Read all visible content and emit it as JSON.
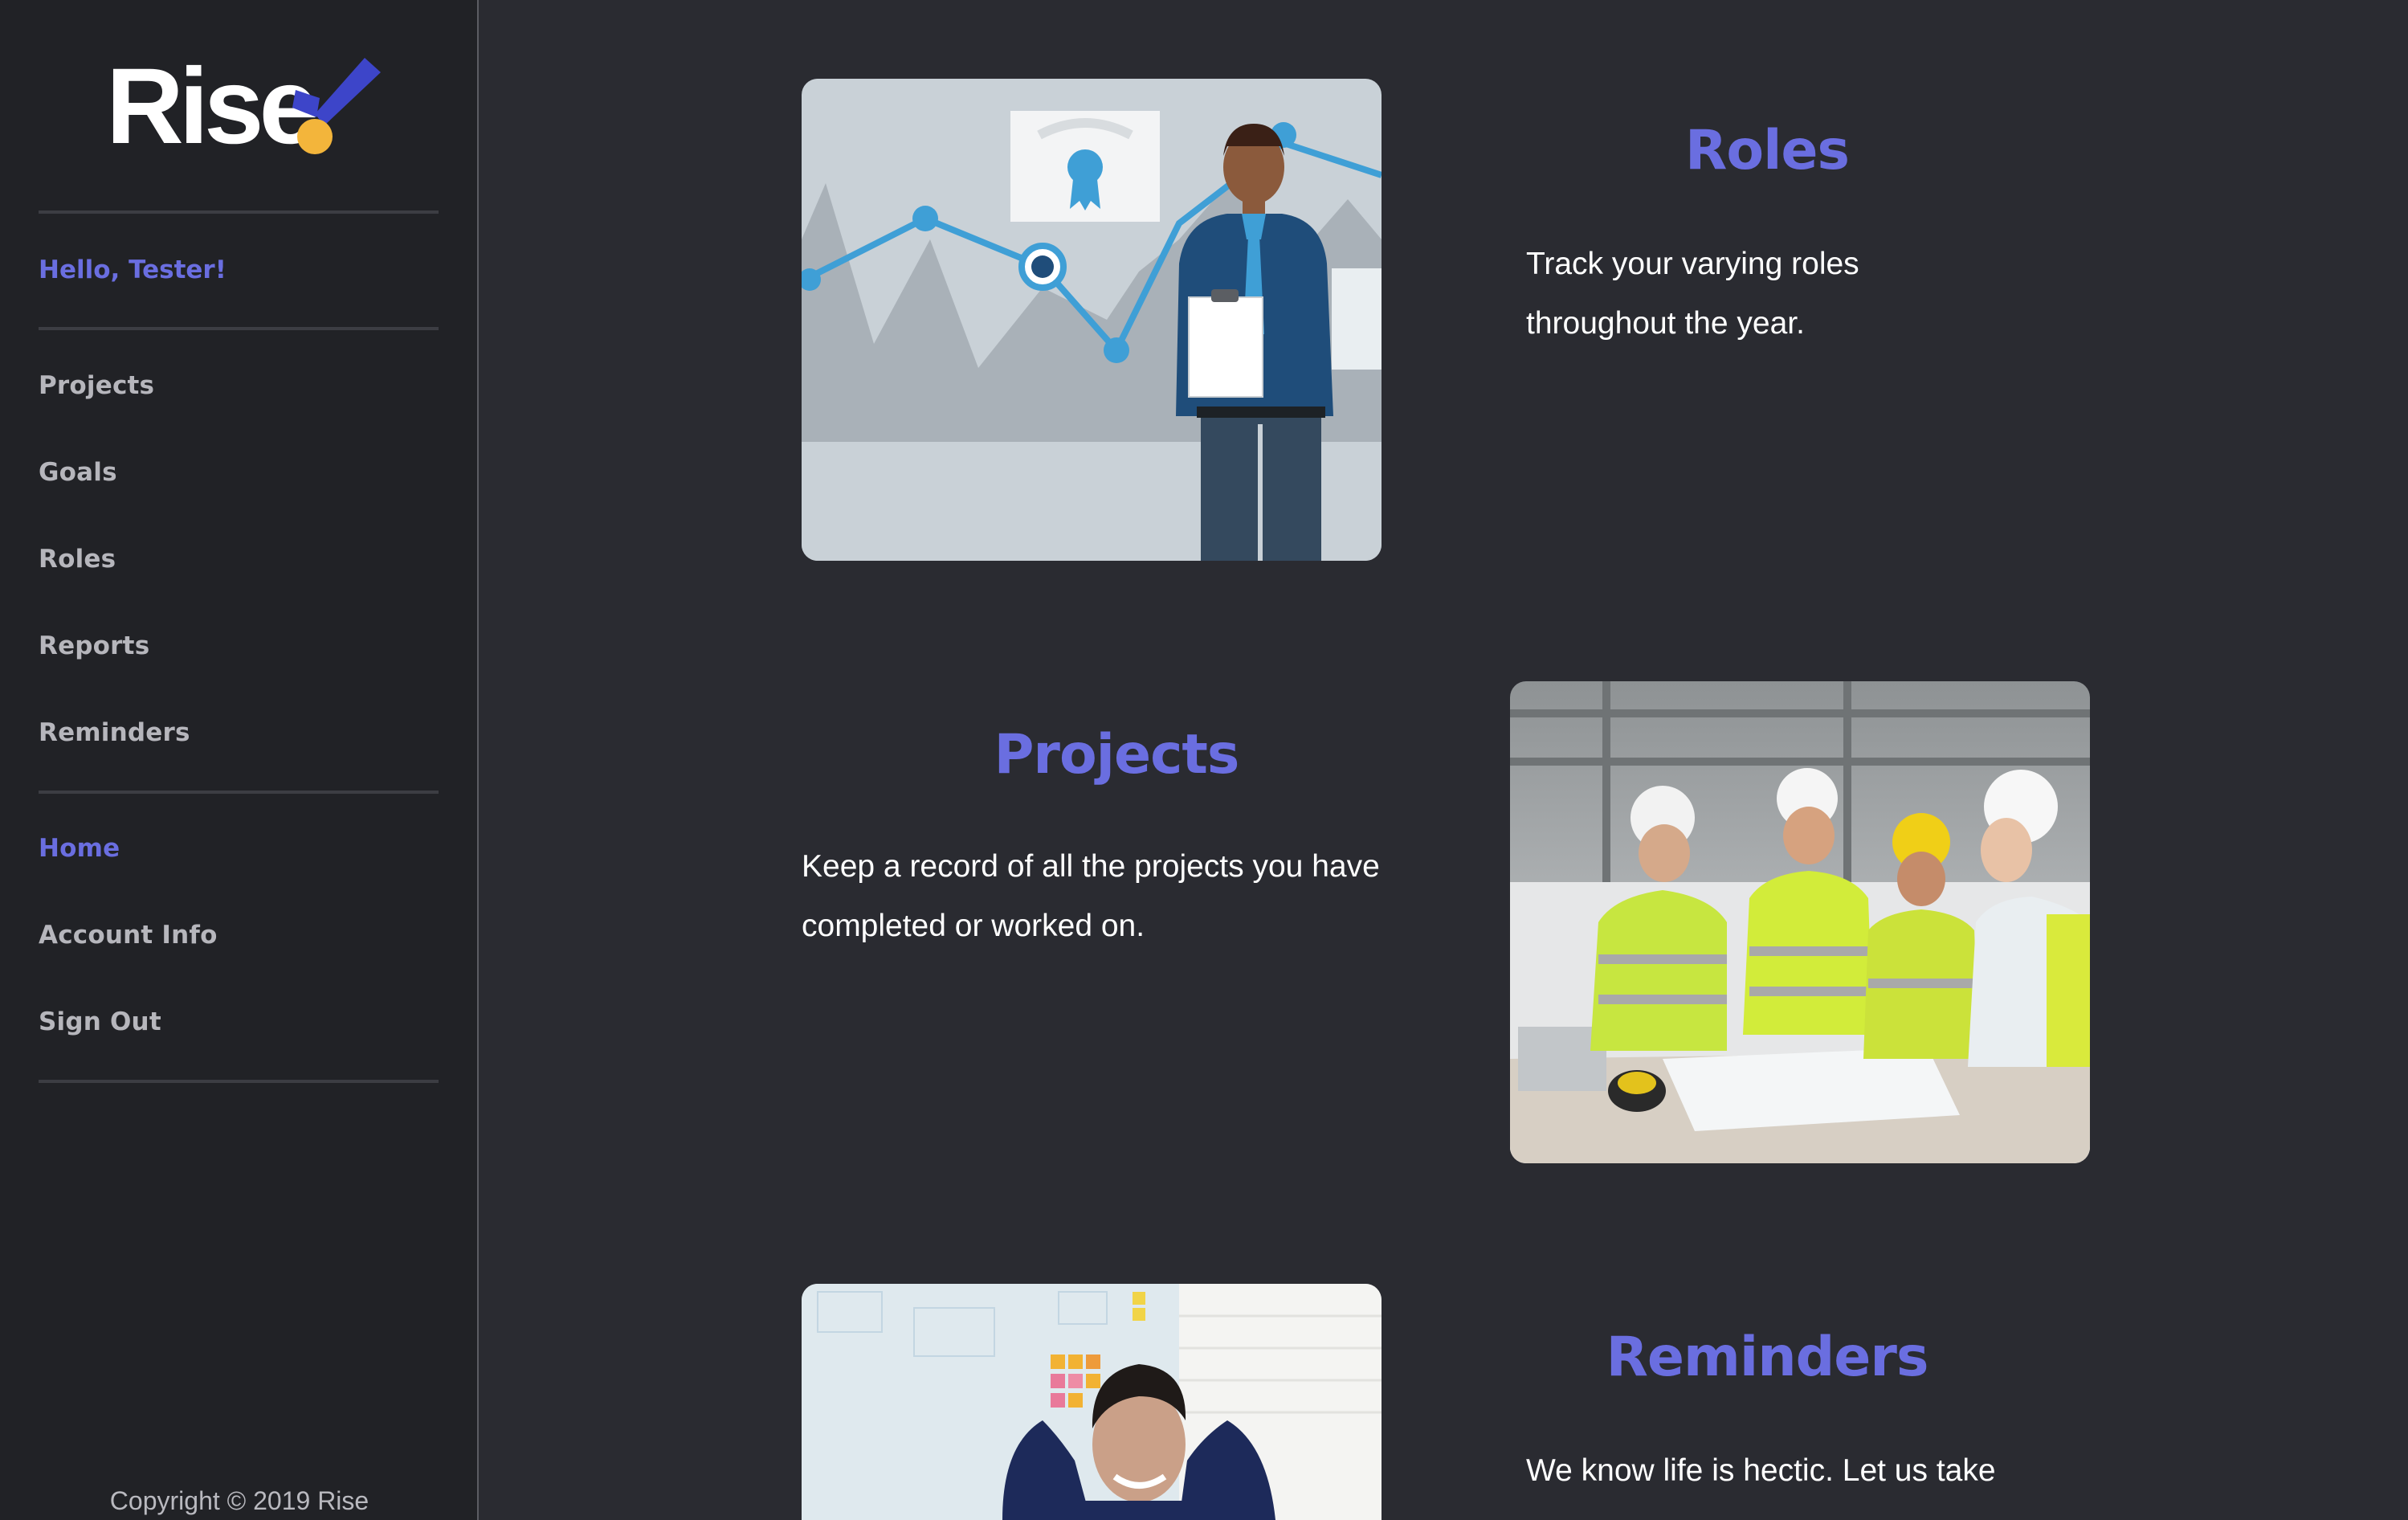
{
  "brand": {
    "name": "Rise",
    "accent": "#6a6ee0",
    "dot_color": "#f3b53b",
    "check_color": "#3d45c9"
  },
  "sidebar": {
    "greeting": "Hello, Tester!",
    "items": [
      {
        "label": "Projects"
      },
      {
        "label": "Goals"
      },
      {
        "label": "Roles"
      },
      {
        "label": "Reports"
      },
      {
        "label": "Reminders"
      }
    ],
    "account_items": [
      {
        "label": "Home",
        "active": true
      },
      {
        "label": "Account Info"
      },
      {
        "label": "Sign Out"
      }
    ],
    "copyright": "Copyright © 2019 Rise"
  },
  "features": [
    {
      "title": "Roles",
      "description_line1": "Track your varying roles",
      "description_line2": "throughout the year.",
      "image": "business-man-chart-illustration"
    },
    {
      "title": "Projects",
      "description_line1": "Keep a record of all the projects you have",
      "description_line2": "completed or worked on.",
      "image": "construction-team-photo"
    },
    {
      "title": "Reminders",
      "description_line1": "We know life is hectic. Let us take",
      "image": "relaxed-man-photo"
    }
  ]
}
